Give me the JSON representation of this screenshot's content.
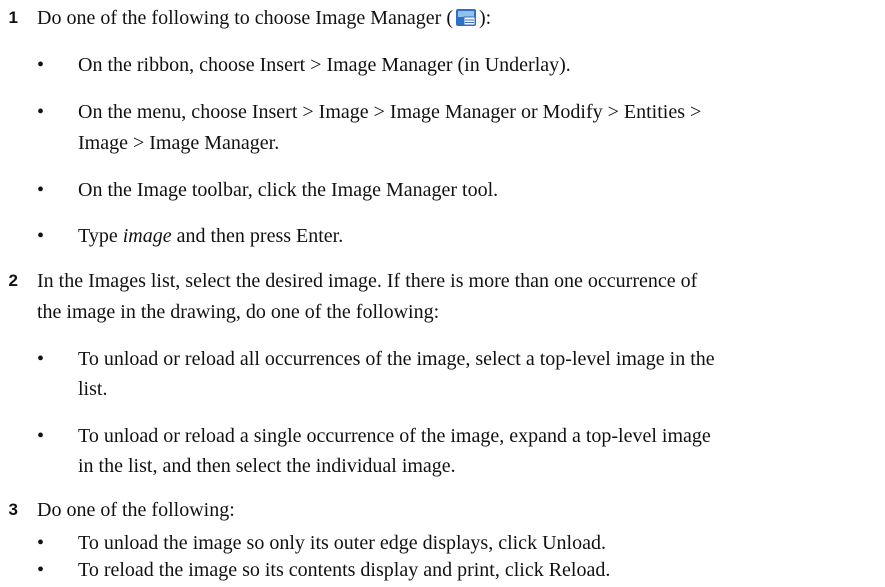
{
  "steps": [
    {
      "number": "1",
      "text_before_icon": "Do one of the following to choose Image Manager (",
      "icon": "image-manager-icon",
      "text_after_icon": "):",
      "bullets": [
        "On the ribbon, choose Insert > Image Manager (in Underlay).",
        "On the menu, choose Insert > Image > Image Manager or Modify > Entities >",
        "Image > Image Manager.",
        "On the Image toolbar, click the Image Manager tool.",
        "and then press Enter."
      ],
      "typed_word": "image",
      "type_prefix": "Type"
    },
    {
      "number": "2",
      "lines": [
        "In the Images list, select the desired image. If there is more than one occurrence of",
        "the image in the drawing, do one of the following:"
      ],
      "bullets": [
        "To unload or reload all occurrences of the image, select a top-level image in the",
        "list.",
        "To unload or reload a single occurrence of the image, expand a top-level image",
        "in the list, and then select the individual image."
      ]
    },
    {
      "number": "3",
      "text": "Do one of the following:",
      "bullets": [
        "To unload the image so only its outer edge displays, click Unload.",
        "To reload the image so its contents display and print, click Reload."
      ]
    }
  ],
  "bullet_glyph": "•",
  "colors": {
    "icon_blue": "#2f6fc4",
    "icon_light": "#8fc3ee",
    "text": "#111111"
  }
}
